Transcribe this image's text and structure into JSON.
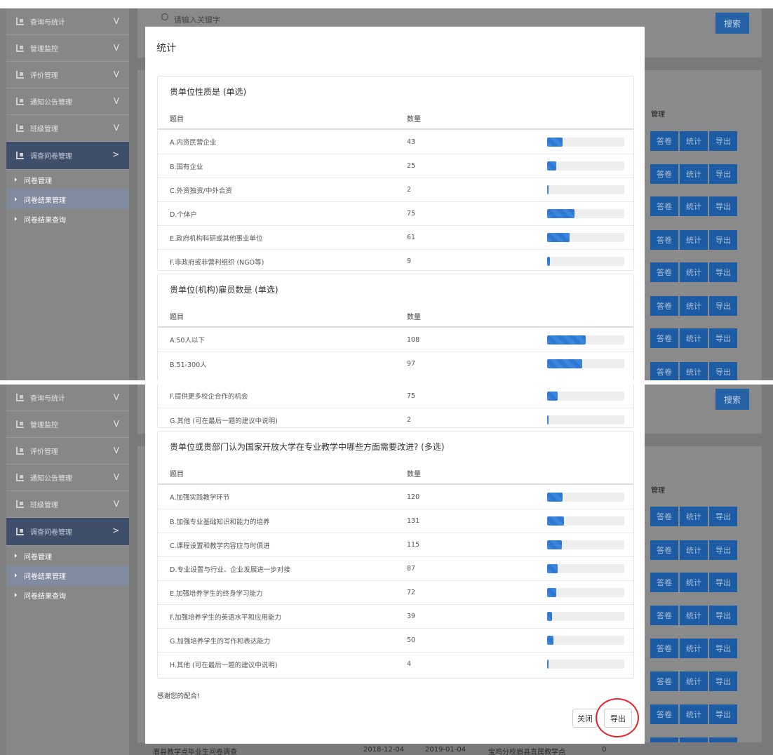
{
  "sidebar": {
    "items": [
      {
        "label": "查询与统计",
        "icon": "folder-tree-icon"
      },
      {
        "label": "管理监控",
        "icon": "folder-tree-icon"
      },
      {
        "label": "评价管理",
        "icon": "folder-tree-icon"
      },
      {
        "label": "通知公告管理",
        "icon": "folder-tree-icon"
      },
      {
        "label": "班级管理",
        "icon": "folder-tree-icon"
      },
      {
        "label": "调查问卷管理",
        "icon": "folder-tree-icon",
        "active": true
      }
    ],
    "subitems": [
      {
        "label": "问卷管理"
      },
      {
        "label": "问卷结果管理",
        "highlighted": true
      },
      {
        "label": "问卷结果查询"
      }
    ]
  },
  "search": {
    "placeholder": "请输入关键字",
    "button_label": "搜索"
  },
  "table": {
    "manage_header": "管理",
    "actions": [
      "答卷",
      "统计",
      "导出"
    ],
    "footer_row": [
      "眉县教学点毕业生问卷调查",
      "2018-12-04",
      "2019-01-04",
      "宝鸡分校眉县直属教学点",
      "0"
    ]
  },
  "modal": {
    "title": "统计",
    "col_question": "题目",
    "col_count": "数量",
    "q1": {
      "title": "贵单位性质是 (单选)",
      "rows": [
        {
          "label": "A.内资民营企业",
          "count": "43",
          "pct": 0.2
        },
        {
          "label": "B.国有企业",
          "count": "25",
          "pct": 0.12
        },
        {
          "label": "C.外资独资/中外合资",
          "count": "2",
          "pct": 0.01
        },
        {
          "label": "D.个体户",
          "count": "75",
          "pct": 0.35
        },
        {
          "label": "E.政府机构科研或其他事业单位",
          "count": "61",
          "pct": 0.29
        },
        {
          "label": "F.非政府或非营利组织 (NGO等)",
          "count": "9",
          "pct": 0.04
        }
      ]
    },
    "q2": {
      "title": "贵单位(机构)雇员数是 (单选)",
      "rows": [
        {
          "label": "A.50人以下",
          "count": "108",
          "pct": 0.5
        },
        {
          "label": "B.51-300人",
          "count": "97",
          "pct": 0.45
        }
      ]
    },
    "q3_tail": {
      "rows": [
        {
          "label": "F.提供更多校企合作的机会",
          "count": "75",
          "pct": 0.14
        },
        {
          "label": "G.其他 (可在最后一题的建议中说明)",
          "count": "2",
          "pct": 0.0
        }
      ]
    },
    "q4": {
      "title": "贵单位或贵部门认为国家开放大学在专业教学中哪些方面需要改进? (多选)",
      "rows": [
        {
          "label": "A.加强实践教学环节",
          "count": "120",
          "pct": 0.2
        },
        {
          "label": "B.加强专业基础知识和能力的培养",
          "count": "131",
          "pct": 0.22
        },
        {
          "label": "C.课程设置和教学内容应与时俱进",
          "count": "115",
          "pct": 0.19
        },
        {
          "label": "D.专业设置与行业、企业发展进一步对接",
          "count": "87",
          "pct": 0.14
        },
        {
          "label": "E.加强培养学生的终身学习能力",
          "count": "72",
          "pct": 0.12
        },
        {
          "label": "F.加强培养学生的英语水平和应用能力",
          "count": "39",
          "pct": 0.06
        },
        {
          "label": "G.加强培养学生的写作和表达能力",
          "count": "50",
          "pct": 0.08
        },
        {
          "label": "H.其他 (可在最后一题的建议中说明)",
          "count": "4",
          "pct": 0.01
        }
      ]
    },
    "thanks": "感谢您的配合!",
    "close_label": "关闭",
    "export_label": "导出"
  },
  "colors": {
    "accent": "#2563a6",
    "bar": "#3a86de",
    "highlight_circle": "#e3242b",
    "sidebar_active": "#3f4f6b"
  }
}
